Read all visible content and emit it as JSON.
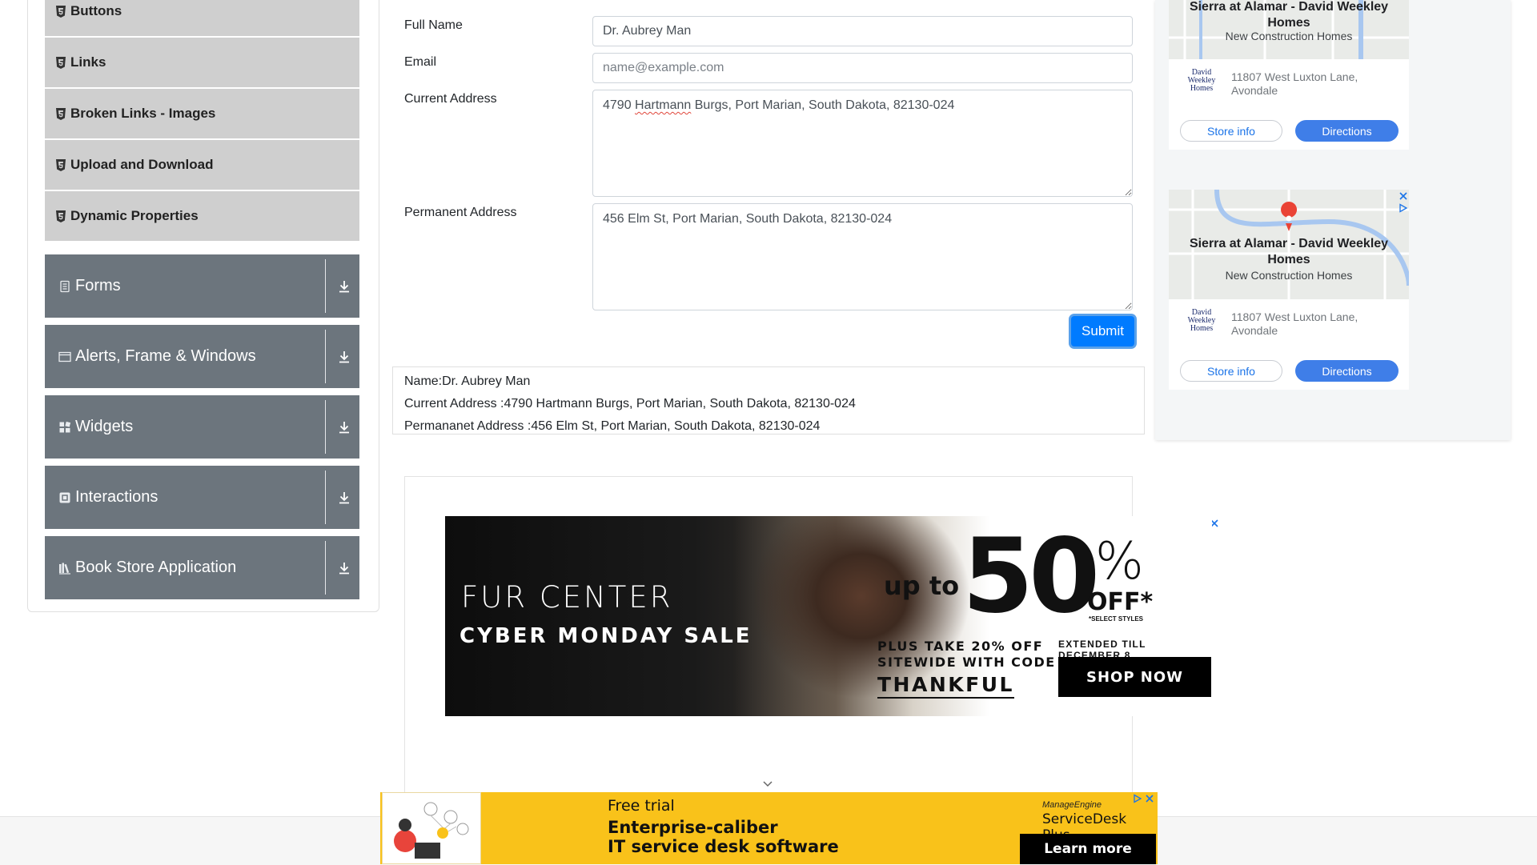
{
  "sidebar": {
    "elements_items": [
      {
        "label": "Buttons"
      },
      {
        "label": "Links"
      },
      {
        "label": "Broken Links - Images"
      },
      {
        "label": "Upload and Download"
      },
      {
        "label": "Dynamic Properties"
      }
    ],
    "groups": [
      {
        "label": "Forms",
        "icon": "document-icon"
      },
      {
        "label": "Alerts, Frame & Windows",
        "icon": "window-icon"
      },
      {
        "label": "Widgets",
        "icon": "widgets-icon"
      },
      {
        "label": "Interactions",
        "icon": "interactions-icon"
      },
      {
        "label": "Book Store Application",
        "icon": "books-icon"
      }
    ]
  },
  "form": {
    "full_name_label": "Full Name",
    "full_name_value": "Dr. Aubrey Man",
    "email_label": "Email",
    "email_placeholder": "name@example.com",
    "email_value": "",
    "current_address_label": "Current Address",
    "current_address_value_pre": "4790 ",
    "current_address_value_misspelled": "Hartmann",
    "current_address_value_post": " Burgs, Port Marian, South Dakota, 82130-024",
    "permanent_address_label": "Permanent Address",
    "permanent_address_value": "456 Elm St, Port Marian, South Dakota, 82130-024",
    "submit_label": "Submit"
  },
  "output": {
    "name": "Name:Dr. Aubrey Man",
    "current_address": "Current Address :4790 Hartmann Burgs, Port Marian, South Dakota, 82130-024",
    "permanent_address": "Permananet Address :456 Elm St, Port Marian, South Dakota, 82130-024"
  },
  "right_ads": [
    {
      "title_line1": "Sierra at Alamar - David Weekley",
      "title_line2": "Homes",
      "subtitle": "New Construction Homes",
      "logo_text": [
        "David",
        "Weekley",
        "Homes"
      ],
      "address_line1": "11807 West Luxton Lane,",
      "address_line2": "Avondale",
      "store_info_label": "Store info",
      "directions_label": "Directions"
    },
    {
      "title_line1": "Sierra at Alamar - David Weekley",
      "title_line2": "Homes",
      "subtitle": "New Construction Homes",
      "logo_text": [
        "David",
        "Weekley",
        "Homes"
      ],
      "address_line1": "11807 West Luxton Lane,",
      "address_line2": "Avondale",
      "store_info_label": "Store info",
      "directions_label": "Directions"
    }
  ],
  "fur_ad": {
    "brand": "FUR CENTER",
    "headline": "CYBER MONDAY SALE",
    "up_to": "up to",
    "big_number": "50",
    "percent": "%",
    "off": "OFF*",
    "select_styles": "*SELECT STYLES",
    "plus_line1": "PLUS TAKE 20% OFF",
    "plus_line2": "SITEWIDE WITH CODE",
    "code": "THANKFUL",
    "extended": "EXTENDED TILL DECEMBER 8",
    "cta": "SHOP NOW"
  },
  "bottom_ad": {
    "line1": "Free trial",
    "line2": "Enterprise-caliber",
    "line3": "IT service desk software",
    "brand_small": "ManageEngine",
    "brand_product": "ServiceDesk Plus",
    "cta": "Learn more"
  },
  "colors": {
    "accent": "#007bff",
    "sidebar_group": "#6c757d",
    "sidebar_item": "#cfcfcf",
    "ad_directions": "#3f7ee8",
    "bottom_ad_bg": "#f9c21a"
  }
}
